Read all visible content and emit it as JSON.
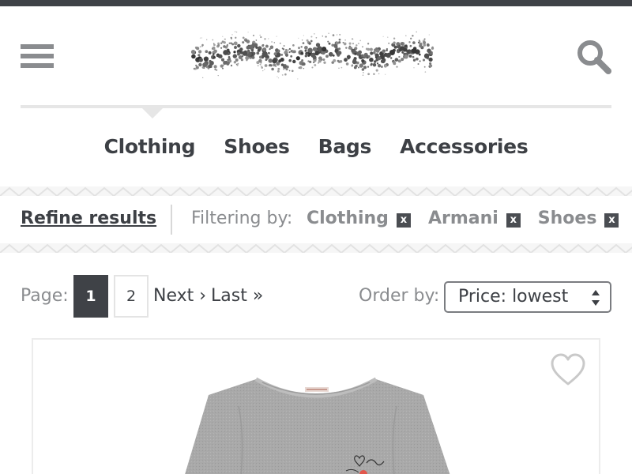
{
  "header": {
    "menu_icon": "hamburger-menu-icon",
    "search_icon": "search-icon",
    "logo": "dotted-logo-graphic"
  },
  "nav": {
    "items": [
      "Clothing",
      "Shoes",
      "Bags",
      "Accessories"
    ],
    "active": "Clothing"
  },
  "filters": {
    "refine_label": "Refine results",
    "filtering_label": "Filtering by:",
    "chips": [
      "Clothing",
      "Armani",
      "Shoes"
    ],
    "remove_glyph": "x"
  },
  "pagination": {
    "label": "Page:",
    "pages": [
      "1",
      "2"
    ],
    "current": "1",
    "next": "Next ›",
    "last": "Last »"
  },
  "order": {
    "label": "Order by:",
    "selected": "Price: lowest"
  },
  "product": {
    "favorite_icon": "heart-outline-icon",
    "image": "grey-t-shirt-photo"
  },
  "colors": {
    "dark": "#3f4247",
    "text": "#3d4045",
    "muted": "#8a8c8f",
    "border": "#e6e6e6"
  }
}
